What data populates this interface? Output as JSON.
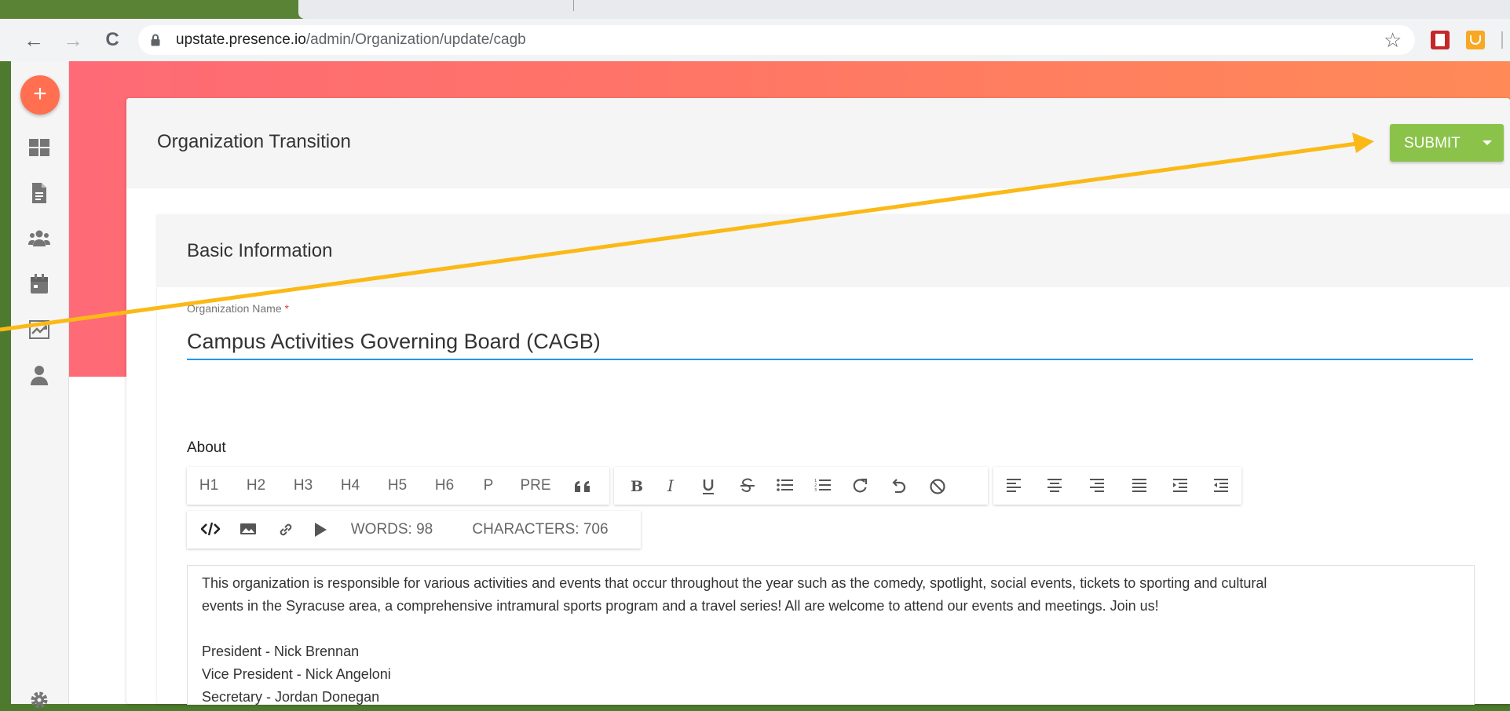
{
  "browser": {
    "url_host": "upstate.presence.io",
    "url_path": "/admin/Organization/update/cagb",
    "back_icon": "←",
    "forward_icon": "→",
    "reload_icon": "C",
    "star_icon": "☆"
  },
  "sidebar": {
    "fab_label": "+",
    "items": [
      "dashboard-icon",
      "document-icon",
      "groups-icon",
      "calendar-icon",
      "analytics-icon",
      "person-icon"
    ],
    "footer_icon": "settings-icon"
  },
  "header": {
    "title": "Organization Transition",
    "submit_label": "SUBMIT"
  },
  "section": {
    "title": "Basic Information",
    "org_name_label": "Organization Name",
    "org_name_required": "*",
    "org_name_value": "Campus Activities Governing Board (CAGB)",
    "about_label": "About"
  },
  "editor_toolbar": {
    "headings": [
      "H1",
      "H2",
      "H3",
      "H4",
      "H5",
      "H6",
      "P",
      "PRE"
    ],
    "words": "WORDS: 98",
    "characters": "CHARACTERS: 706"
  },
  "editor": {
    "lines": [
      "This organization is responsible for various activities and events that occur throughout the year such as the comedy, spotlight, social events, tickets to sporting and cultural",
      "events in the Syracuse area, a comprehensive intramural sports program and a travel series! All are welcome to attend our events and meetings. Join us!",
      "",
      "President - Nick Brennan",
      "Vice President - Nick Angeloni",
      "Secretary - Jordan Donegan"
    ]
  },
  "colors": {
    "accent_blue": "#2196f3",
    "submit_green": "#8bc34a",
    "hero_start": "#fe6a76",
    "hero_end": "#ff8a57",
    "fab": "#ff6f50",
    "annotation_arrow": "#fbb917",
    "outer_frame": "#4e7a2e"
  }
}
